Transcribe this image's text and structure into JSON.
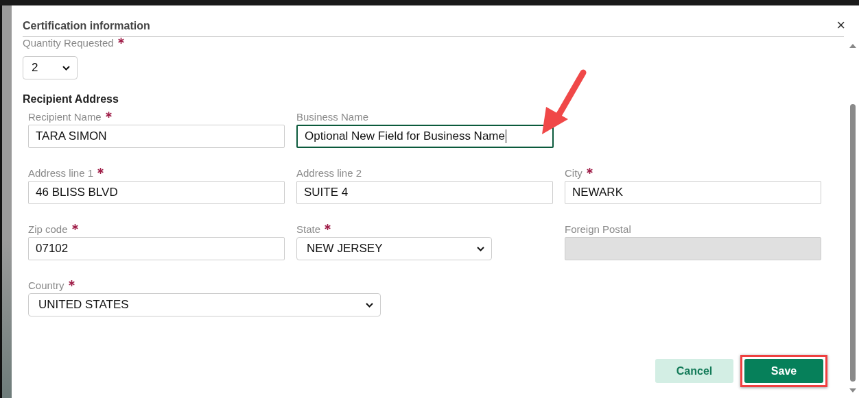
{
  "dialog": {
    "title": "Certification information",
    "close": "×"
  },
  "quantity": {
    "label": "Quantity Requested",
    "required": true,
    "value": "2"
  },
  "section_title": "Recipient Address",
  "rows": [
    [
      {
        "label": "Recipient Name",
        "required": true,
        "kind": "text",
        "value": "TARA SIMON",
        "focused": false
      },
      {
        "label": "Business Name",
        "required": false,
        "kind": "text",
        "value": "Optional New Field for Business Name",
        "focused": true
      }
    ],
    [
      {
        "label": "Address line 1",
        "required": true,
        "kind": "text",
        "value": "46 BLISS BLVD",
        "focused": false
      },
      {
        "label": "Address line 2",
        "required": false,
        "kind": "text",
        "value": "SUITE 4",
        "focused": false
      },
      {
        "label": "City",
        "required": true,
        "kind": "text",
        "value": "NEWARK",
        "focused": false
      }
    ],
    [
      {
        "label": "Zip code",
        "required": true,
        "kind": "text",
        "value": "07102",
        "focused": false
      },
      {
        "label": "State",
        "required": true,
        "kind": "select",
        "value": "NEW JERSEY",
        "focused": false
      },
      {
        "label": "Foreign Postal",
        "required": false,
        "kind": "disabled",
        "focused": false
      }
    ],
    [
      {
        "label": "Country",
        "required": true,
        "kind": "select",
        "value": "UNITED STATES",
        "focused": false
      }
    ]
  ],
  "buttons": [
    {
      "label": "Cancel",
      "kind": "secondary",
      "highlighted": false
    },
    {
      "label": "Save",
      "kind": "primary",
      "highlighted": true
    }
  ],
  "annotation_arrow": true
}
